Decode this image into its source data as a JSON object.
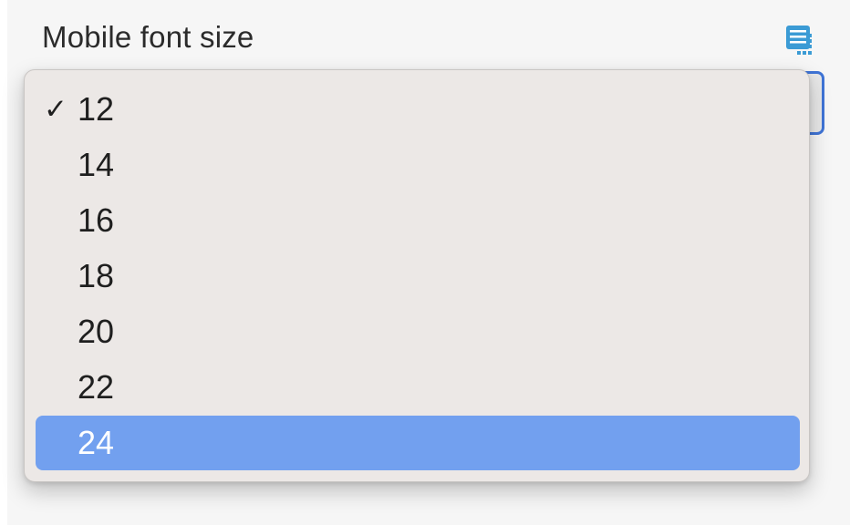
{
  "field": {
    "label": "Mobile font size"
  },
  "icons": {
    "helper": "table-edit-icon"
  },
  "select": {
    "selected_value": "12",
    "options": [
      {
        "value": "12",
        "checked": true,
        "highlighted": false
      },
      {
        "value": "14",
        "checked": false,
        "highlighted": false
      },
      {
        "value": "16",
        "checked": false,
        "highlighted": false
      },
      {
        "value": "18",
        "checked": false,
        "highlighted": false
      },
      {
        "value": "20",
        "checked": false,
        "highlighted": false
      },
      {
        "value": "22",
        "checked": false,
        "highlighted": false
      },
      {
        "value": "24",
        "checked": false,
        "highlighted": true
      }
    ],
    "check_glyph": "✓"
  },
  "colors": {
    "focus_border": "#3f74d6",
    "highlight": "#72a0ef",
    "icon": "#3b9bd5"
  }
}
